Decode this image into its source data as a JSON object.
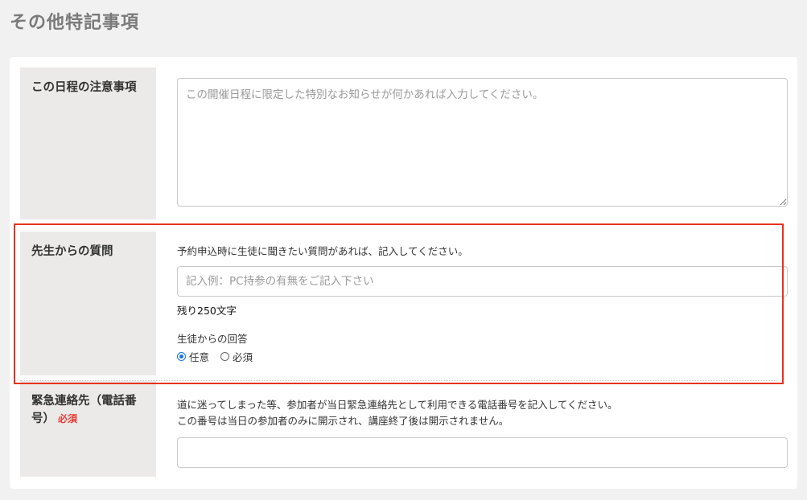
{
  "page": {
    "title": "その他特記事項"
  },
  "notes": {
    "label": "この日程の注意事項",
    "placeholder": "この開催日程に限定した特別なお知らせが何かあれば入力してください。",
    "value": ""
  },
  "question": {
    "label": "先生からの質問",
    "help": "予約申込時に生徒に聞きたい質問があれば、記入してください。",
    "placeholder": "記入例：PC持参の有無をご記入下さい",
    "value": "",
    "remaining": "残り250文字",
    "answer_label": "生徒からの回答",
    "answer_options": [
      {
        "label": "任意",
        "checked": true
      },
      {
        "label": "必須",
        "checked": false
      }
    ]
  },
  "emergency": {
    "label": "緊急連絡先（電話番号）",
    "required_badge": "必須",
    "help_line1": "道に迷ってしまった等、参加者が当日緊急連絡先として利用できる電話番号を記入してください。",
    "help_line2": "この番号は当日の参加者のみに開示され、講座終了後は開示されません。",
    "value": ""
  },
  "colors": {
    "highlight": "#e8321e",
    "required": "#e53935",
    "radio_accent": "#1a73e8",
    "label_bg": "#ebeae8"
  }
}
